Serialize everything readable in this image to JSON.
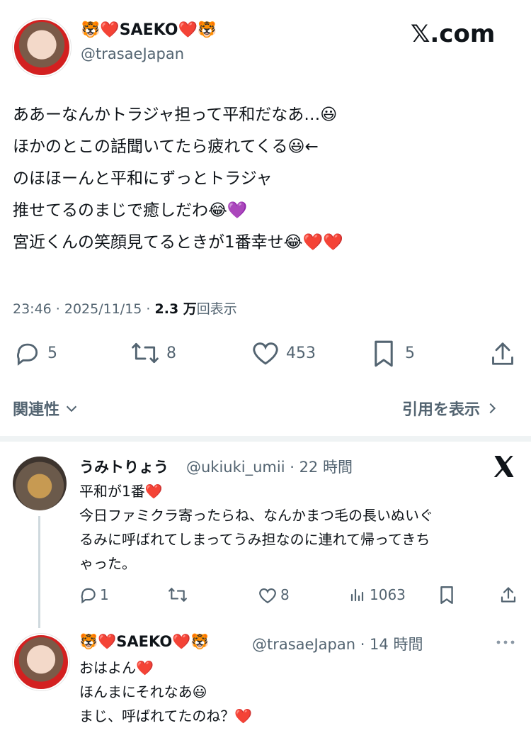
{
  "header": {
    "display_name": "🐯❤️SAEKO❤️🐯",
    "handle": "@trasaeJapan",
    "brand": "𝕏.com"
  },
  "tweet": {
    "lines": [
      "ああーなんかトラジャ担って平和だなあ…😃",
      "ほかのとこの話聞いてたら疲れてくる😃←",
      "のほほーんと平和にずっとトラジャ",
      "推せてるのまじで癒しだわ😂💜",
      "宮近くんの笑顔見てるときが1番幸せ😂❤️❤️"
    ],
    "time": "23:46 · 2025/11/15 · ",
    "views_count": "2.3 万",
    "views_label": "回表示",
    "stats": {
      "replies": "5",
      "retweets": "8",
      "likes": "453",
      "bookmarks": "5"
    }
  },
  "tabs": {
    "relevance": "関連性",
    "view_quotes": "引用を表示"
  },
  "reply1": {
    "name": "うみトりょう",
    "meta": "@ukiuki_umii · 22 時間",
    "lines": [
      "平和が1番❤️",
      "今日ファミクラ寄ったらね、なんかまつ毛の長いぬいぐ",
      "るみに呼ばれてしまってうみ担なのに連れて帰ってきち",
      "ゃった。"
    ],
    "stats": {
      "replies": "1",
      "likes": "8",
      "views": "1063"
    }
  },
  "reply2": {
    "name": "🐯❤️SAEKO❤️🐯",
    "meta": "@trasaeJapan · 14 時間",
    "lines": [
      "おはよん❤️",
      "ほんまにそれなあ😃",
      "まじ、呼ばれてたのね？❤️"
    ]
  },
  "colors": {
    "text": "#0f1419",
    "secondary": "#536471",
    "divider": "#eff3f4"
  }
}
